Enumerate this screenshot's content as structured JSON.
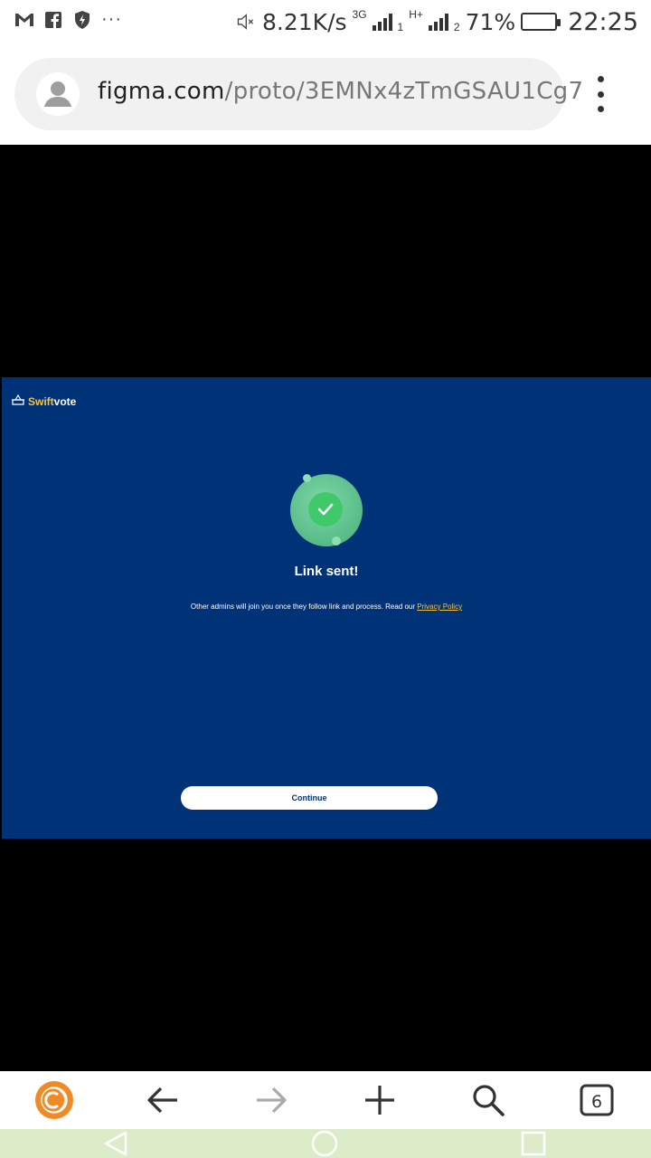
{
  "status_bar": {
    "notification_icons": [
      "gmail-icon",
      "facebook-icon",
      "shield-bolt-icon"
    ],
    "more": "···",
    "net_speed": "8.21K/s",
    "sim1_type": "3G",
    "sim1_index": "1",
    "sim2_type": "H+",
    "sim2_index": "2",
    "battery": "71%",
    "battery_level": 0.71,
    "time": "22:25"
  },
  "browser": {
    "url_domain": "figma.com",
    "url_path": "/proto/3EMNx4zTmGSAU1Cg7"
  },
  "prototype": {
    "logo_prefix": "Swift",
    "logo_suffix": "vote",
    "title": "Link sent!",
    "message": "Other admins will join you once they follow link and process. Read our",
    "privacy_link": "Privacy Policy",
    "continue_label": "Continue",
    "colors": {
      "background": "#003278",
      "accent": "#f6c445",
      "success": "#3fc96a"
    }
  },
  "toolbar": {
    "tab_count": "6",
    "icons": [
      "browser-logo-icon",
      "back-arrow-icon",
      "forward-arrow-icon",
      "new-tab-plus-icon",
      "search-icon",
      "tabs-icon"
    ]
  }
}
